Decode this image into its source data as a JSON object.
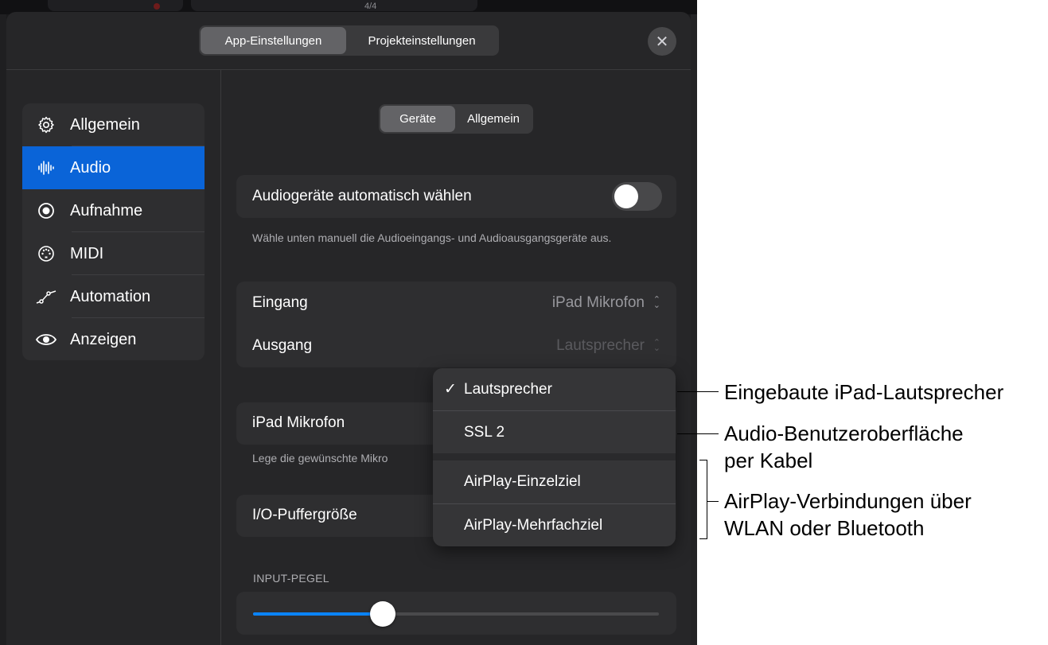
{
  "top_strip": {
    "time_signature": "4/4"
  },
  "modal_tabs": [
    {
      "label": "App-Einstellungen",
      "active": true
    },
    {
      "label": "Projekteinstellungen",
      "active": false
    }
  ],
  "close_label": "✕",
  "sidebar": {
    "items": [
      {
        "label": "Allgemein",
        "icon": "gear-icon",
        "active": false
      },
      {
        "label": "Audio",
        "icon": "waveform-icon",
        "active": true
      },
      {
        "label": "Aufnahme",
        "icon": "record-icon",
        "active": false
      },
      {
        "label": "MIDI",
        "icon": "midi-icon",
        "active": false
      },
      {
        "label": "Automation",
        "icon": "automation-icon",
        "active": false
      },
      {
        "label": "Anzeigen",
        "icon": "eye-icon",
        "active": false
      }
    ]
  },
  "sub_tabs": [
    {
      "label": "Geräte",
      "active": true
    },
    {
      "label": "Allgemein",
      "active": false
    }
  ],
  "auto_select": {
    "label": "Audiogeräte automatisch wählen",
    "enabled": false,
    "footnote": "Wähle unten manuell die Audioeingangs- und Audioausgangsgeräte aus."
  },
  "devices": {
    "input_label": "Eingang",
    "input_value": "iPad Mikrofon",
    "output_label": "Ausgang",
    "output_value": "Lautsprecher",
    "chevron": "⌃⌄"
  },
  "mic": {
    "label": "iPad Mikrofon",
    "footnote": "Lege die gewünschte Mikro"
  },
  "buffer": {
    "label": "I/O-Puffergröße"
  },
  "input_level": {
    "heading": "INPUT-PEGEL",
    "value_fraction": 0.32
  },
  "popup": {
    "check": "✓",
    "items": [
      {
        "label": "Lautsprecher",
        "selected": true
      },
      {
        "label": "SSL 2",
        "selected": false
      },
      {
        "label": "AirPlay-Einzelziel",
        "selected": false
      },
      {
        "label": "AirPlay-Mehrfachziel",
        "selected": false
      }
    ]
  },
  "annotations": {
    "builtin": "Eingebaute iPad-Lautsprecher",
    "interface_line1": "Audio-Benutzeroberfläche",
    "interface_line2": "per Kabel",
    "airplay_line1": "AirPlay-Verbindungen über",
    "airplay_line2": "WLAN oder Bluetooth"
  },
  "colors": {
    "accent": "#0a64d8",
    "slider_fill": "#0a84ff",
    "panel": "#262628",
    "card": "#2e2e30"
  }
}
